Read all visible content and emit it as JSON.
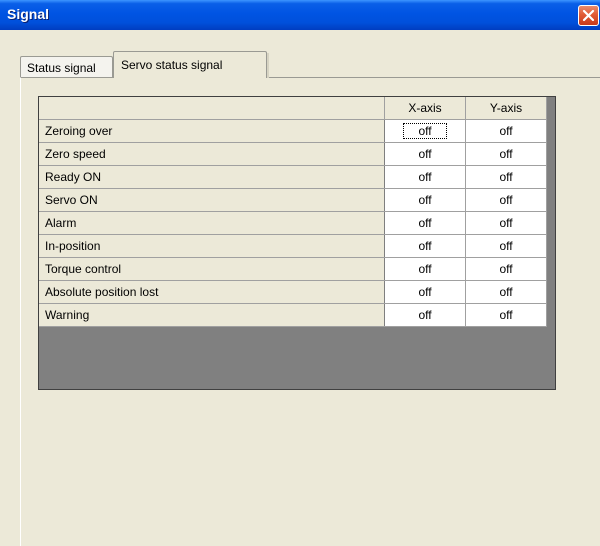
{
  "window": {
    "title": "Signal"
  },
  "tabs": [
    {
      "label": "Status signal",
      "active": false
    },
    {
      "label": "Servo status signal",
      "active": true
    }
  ],
  "grid": {
    "columns": [
      "X-axis",
      "Y-axis"
    ],
    "rows": [
      {
        "label": "Zeroing over",
        "x": "off",
        "y": "off"
      },
      {
        "label": "Zero speed",
        "x": "off",
        "y": "off"
      },
      {
        "label": "Ready ON",
        "x": "off",
        "y": "off"
      },
      {
        "label": "Servo ON",
        "x": "off",
        "y": "off"
      },
      {
        "label": "Alarm",
        "x": "off",
        "y": "off"
      },
      {
        "label": "In-position",
        "x": "off",
        "y": "off"
      },
      {
        "label": "Torque control",
        "x": "off",
        "y": "off"
      },
      {
        "label": "Absolute position lost",
        "x": "off",
        "y": "off"
      },
      {
        "label": "Warning",
        "x": "off",
        "y": "off"
      }
    ]
  },
  "icons": {
    "close": "close-x-icon"
  }
}
